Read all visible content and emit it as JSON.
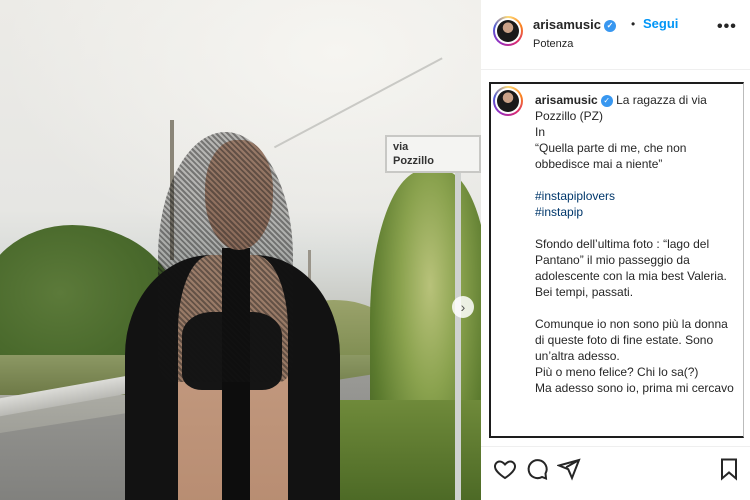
{
  "post": {
    "sign": {
      "line1": "via",
      "line2": "Pozzillo"
    }
  },
  "header": {
    "username": "arisamusic",
    "separator": "•",
    "follow_label": "Segui",
    "location": "Potenza",
    "more_label": "•••"
  },
  "caption": {
    "username": "arisamusic",
    "lines": [
      "La ragazza di via Pozzillo (PZ)",
      "In",
      "“Quella parte di me, che non obbedisce mai a niente”"
    ],
    "hashtags": [
      "#instapiplovers",
      "#instapip"
    ],
    "paragraph2": "Sfondo dell’ultima foto : “lago del Pantano” il mio passeggio da adolescente con la mia best Valeria. Bei tempi, passati.",
    "paragraph3": "Comunque io non sono più la donna di queste foto di fine estate. Sono un’altra adesso.",
    "paragraph4": "Più o meno felice? Chi lo sa(?)",
    "paragraph5": "Ma adesso sono io, prima mi cercavo"
  },
  "icons": {
    "verified": "verified-badge",
    "like": "heart-icon",
    "comment": "comment-icon",
    "share": "send-icon",
    "save": "bookmark-icon",
    "next": "chevron-right-icon"
  },
  "colors": {
    "follow": "#0095f6",
    "verified": "#3897f0",
    "hashtag": "#00376b"
  }
}
